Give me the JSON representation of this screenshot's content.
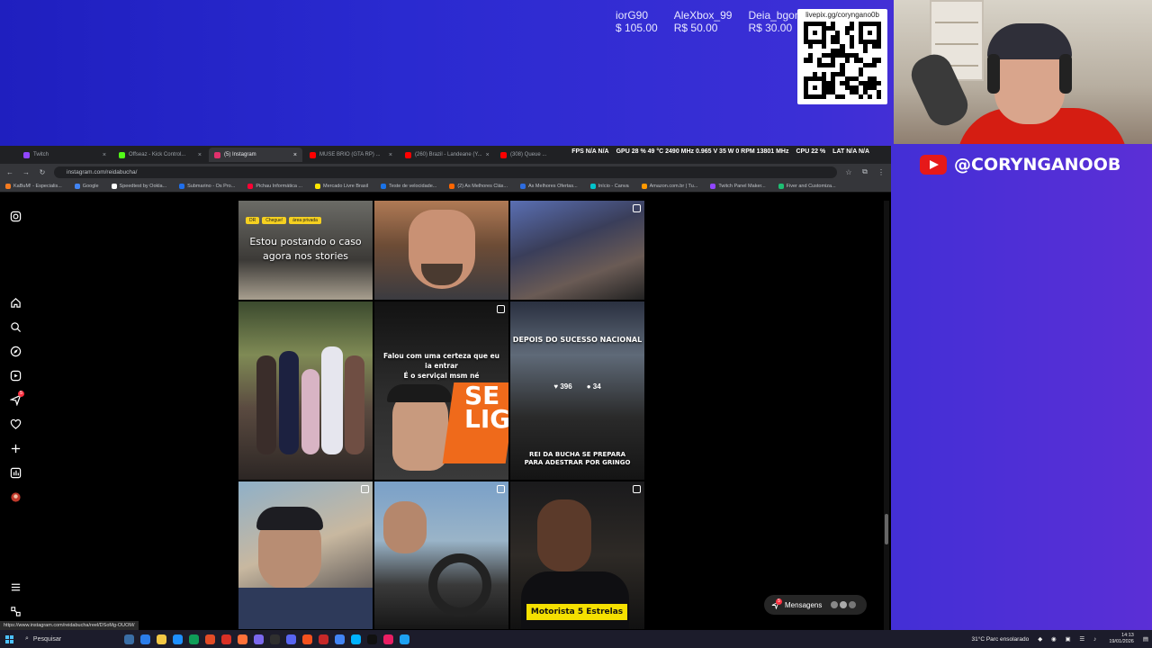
{
  "overlay": {
    "donations": [
      {
        "name": "iorG90",
        "amount": "$ 105.00"
      },
      {
        "name": "AleXbox_99",
        "amount": "R$ 50.00"
      },
      {
        "name": "Deia_bgon",
        "amount": "R$ 30.00"
      }
    ],
    "qr_url": "livepix.gg/coryngano0b",
    "youtube_handle": "@CORYNGANOOB"
  },
  "browser": {
    "tabs": [
      {
        "label": "Twitch",
        "color": "#9146ff",
        "active": false
      },
      {
        "label": "Offseaz - Kick Control...",
        "color": "#53fc18",
        "active": false
      },
      {
        "label": "(5) Instagram",
        "color": "#e1306c",
        "active": true
      },
      {
        "label": "MUSE BRIO (GTA RP) ...",
        "color": "#ff0000",
        "active": false
      },
      {
        "label": "(260) Brazil - Landeane (Y...",
        "color": "#ff0000",
        "active": false
      },
      {
        "label": "(308) Queue ...",
        "color": "#ff0000",
        "active": false
      }
    ],
    "hwstats": [
      "FPS N/A N/A",
      "GPU 28 % 49 °C 2490 MHz 0.965 V 35 W 0 RPM 13801 MHz",
      "CPU 22 %",
      "LAT N/A N/A"
    ],
    "url": "instagram.com/reidabucha/",
    "bookmarks": [
      {
        "label": "KaBuM! - Especialis...",
        "color": "#f47b20"
      },
      {
        "label": "Google",
        "color": "#4285f4"
      },
      {
        "label": "Speedtest by Ookla...",
        "color": "#ffffff"
      },
      {
        "label": "Submarino - Os Pro...",
        "color": "#1f6feb"
      },
      {
        "label": "Pichau Informática ...",
        "color": "#ff0033"
      },
      {
        "label": "Mercado Livre Brasil",
        "color": "#ffe600"
      },
      {
        "label": "Teste de velocidade...",
        "color": "#1a73e8"
      },
      {
        "label": "(2) As Melhores Clás...",
        "color": "#ff6600"
      },
      {
        "label": "As Melhores Ofertas...",
        "color": "#2d6cdf"
      },
      {
        "label": "Início - Canva",
        "color": "#00c4cc"
      },
      {
        "label": "Amazon.com.br | Tu...",
        "color": "#ff9900"
      },
      {
        "label": "Twitch Panel Maker...",
        "color": "#9146ff"
      },
      {
        "label": "Fiver and Customiza...",
        "color": "#1dbf73"
      }
    ],
    "status_url": "https://www.instagram.com/reidabucha/reel/DSoMg-OUOM/"
  },
  "sidenav": {
    "items": [
      "instagram-logo-icon",
      "home-icon",
      "search-icon",
      "explore-icon",
      "reels-icon",
      "messages-icon",
      "notifications-icon",
      "create-icon",
      "dashboard-icon",
      "profile-icon",
      "menu-icon",
      "meta-icon"
    ],
    "messages_badge": "5"
  },
  "posts": {
    "p1": {
      "chips": [
        "DR",
        "Chegue!",
        "área privada"
      ],
      "caption": "Estou postando o caso agora nos stories"
    },
    "p5": {
      "caption": "Falou com uma certeza que eu ia entrar\nÉ o serviçal msm né",
      "brand": "SE LIG"
    },
    "p6": {
      "title": "DEPOIS DO SUCESSO NACIONAL",
      "likes": "396",
      "comments": "34",
      "caption": "REI DA BUCHA SE PREPARA PARA ADESTRAR POR GRINGO"
    },
    "p9": {
      "caption": "Motorista 5 Estrelas"
    }
  },
  "messages_pill": {
    "label": "Mensagens"
  },
  "taskbar": {
    "search_placeholder": "Pesquisar",
    "weather": "31°C Parc ensolarado",
    "time": "14:13",
    "date": "19/01/2026"
  }
}
